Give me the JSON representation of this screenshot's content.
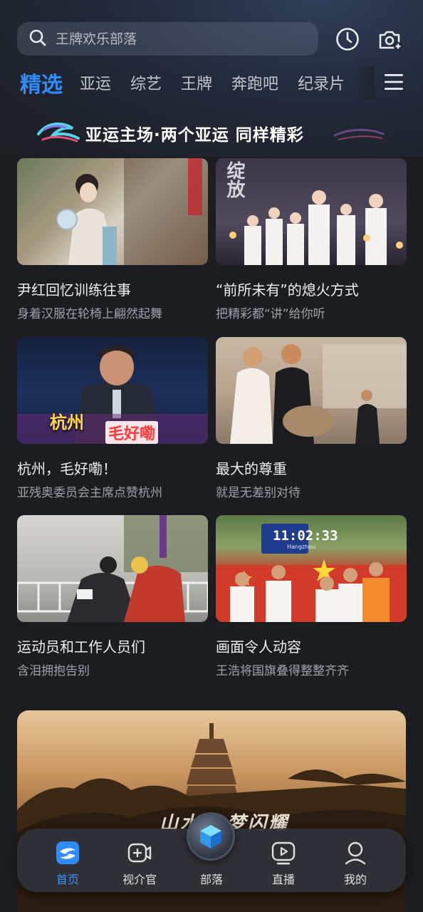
{
  "search": {
    "placeholder": "王牌欢乐部落",
    "icon": "search-icon"
  },
  "top_icons": [
    "history-clock-icon",
    "camera-plus-icon"
  ],
  "tabs": [
    {
      "label": "精选",
      "active": true
    },
    {
      "label": "亚运"
    },
    {
      "label": "综艺"
    },
    {
      "label": "王牌"
    },
    {
      "label": "奔跑吧"
    },
    {
      "label": "纪录片"
    }
  ],
  "banner": {
    "text": "亚运主场·两个亚运 同样精彩"
  },
  "cards": [
    {
      "title": "尹红回忆训练往事",
      "subtitle": "身着汉服在轮椅上翩然起舞"
    },
    {
      "title": "“前所未有”的熄火方式",
      "subtitle": "把精彩都“讲”给你听",
      "overlay": "绽放"
    },
    {
      "title": "杭州，毛好嘞！",
      "subtitle": "亚残奥委员会主席点赞杭州",
      "overlay_1": "杭州",
      "overlay_2": "毛好嘞"
    },
    {
      "title": "最大的尊重",
      "subtitle": "就是无差别对待"
    },
    {
      "title": "运动员和工作人员们",
      "subtitle": "含泪拥抱告别"
    },
    {
      "title": "画面令人动容",
      "subtitle": "王浩将国旗叠得整整齐齐",
      "overlay_clock": "11:02:33",
      "overlay_city": "Hangzhou"
    }
  ],
  "big_card": {
    "caption": "山水 · 梦闪耀"
  },
  "bottom_nav": [
    {
      "label": "首页",
      "icon": "home-logo-icon",
      "active": true
    },
    {
      "label": "视介官",
      "icon": "video-plus-icon"
    },
    {
      "label": "部落",
      "icon": "cube-icon"
    },
    {
      "label": "直播",
      "icon": "live-play-icon"
    },
    {
      "label": "我的",
      "icon": "user-icon"
    }
  ],
  "colors": {
    "accent": "#2f8cff",
    "background": "#1b1d21"
  }
}
